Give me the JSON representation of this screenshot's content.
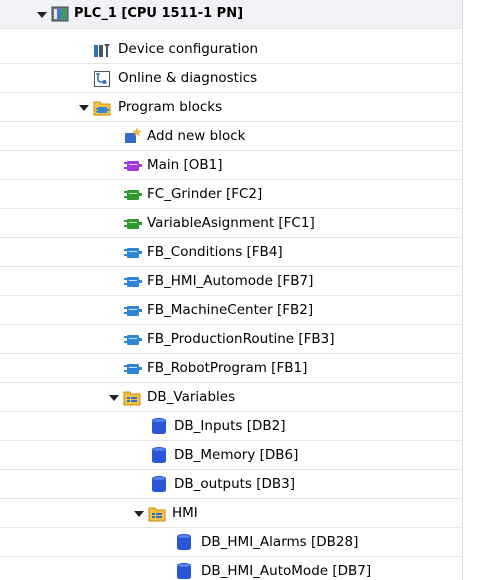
{
  "tree": {
    "plc": {
      "label": "PLC_1 [CPU 1511-1 PN]",
      "icon": "plc-device-icon"
    },
    "device_configuration": {
      "label": "Device configuration",
      "icon": "device-configuration-icon"
    },
    "online_diagnostics": {
      "label": "Online & diagnostics",
      "icon": "online-diagnostics-icon"
    },
    "program_blocks": {
      "label": "Program blocks",
      "icon": "program-blocks-folder-icon"
    },
    "add_new_block": {
      "label": "Add new block",
      "icon": "add-new-block-icon"
    },
    "blocks": [
      {
        "label": "Main [OB1]",
        "color": "#a23bd6",
        "icon": "organization-block-icon"
      },
      {
        "label": "FC_Grinder [FC2]",
        "color": "#2e9a2e",
        "icon": "function-block-icon"
      },
      {
        "label": "VariableAsignment [FC1]",
        "color": "#2e9a2e",
        "icon": "function-block-icon"
      },
      {
        "label": "FB_Conditions [FB4]",
        "color": "#2f86d6",
        "icon": "function-block-icon"
      },
      {
        "label": "FB_HMI_Automode [FB7]",
        "color": "#2f86d6",
        "icon": "function-block-icon"
      },
      {
        "label": "FB_MachineCenter [FB2]",
        "color": "#2f86d6",
        "icon": "function-block-icon"
      },
      {
        "label": "FB_ProductionRoutine [FB3]",
        "color": "#2f86d6",
        "icon": "function-block-icon"
      },
      {
        "label": "FB_RobotProgram [FB1]",
        "color": "#2f86d6",
        "icon": "function-block-icon"
      }
    ],
    "db_variables": {
      "label": "DB_Variables",
      "icon": "db-group-folder-icon"
    },
    "db_items": [
      {
        "label": "DB_Inputs [DB2]",
        "icon": "data-block-icon"
      },
      {
        "label": "DB_Memory [DB6]",
        "icon": "data-block-icon"
      },
      {
        "label": "DB_outputs [DB3]",
        "icon": "data-block-icon"
      }
    ],
    "hmi": {
      "label": "HMI",
      "icon": "db-group-folder-icon"
    },
    "hmi_items": [
      {
        "label": "DB_HMI_Alarms [DB28]",
        "icon": "data-block-icon"
      },
      {
        "label": "DB_HMI_AutoMode [DB7]",
        "icon": "data-block-icon"
      }
    ]
  }
}
